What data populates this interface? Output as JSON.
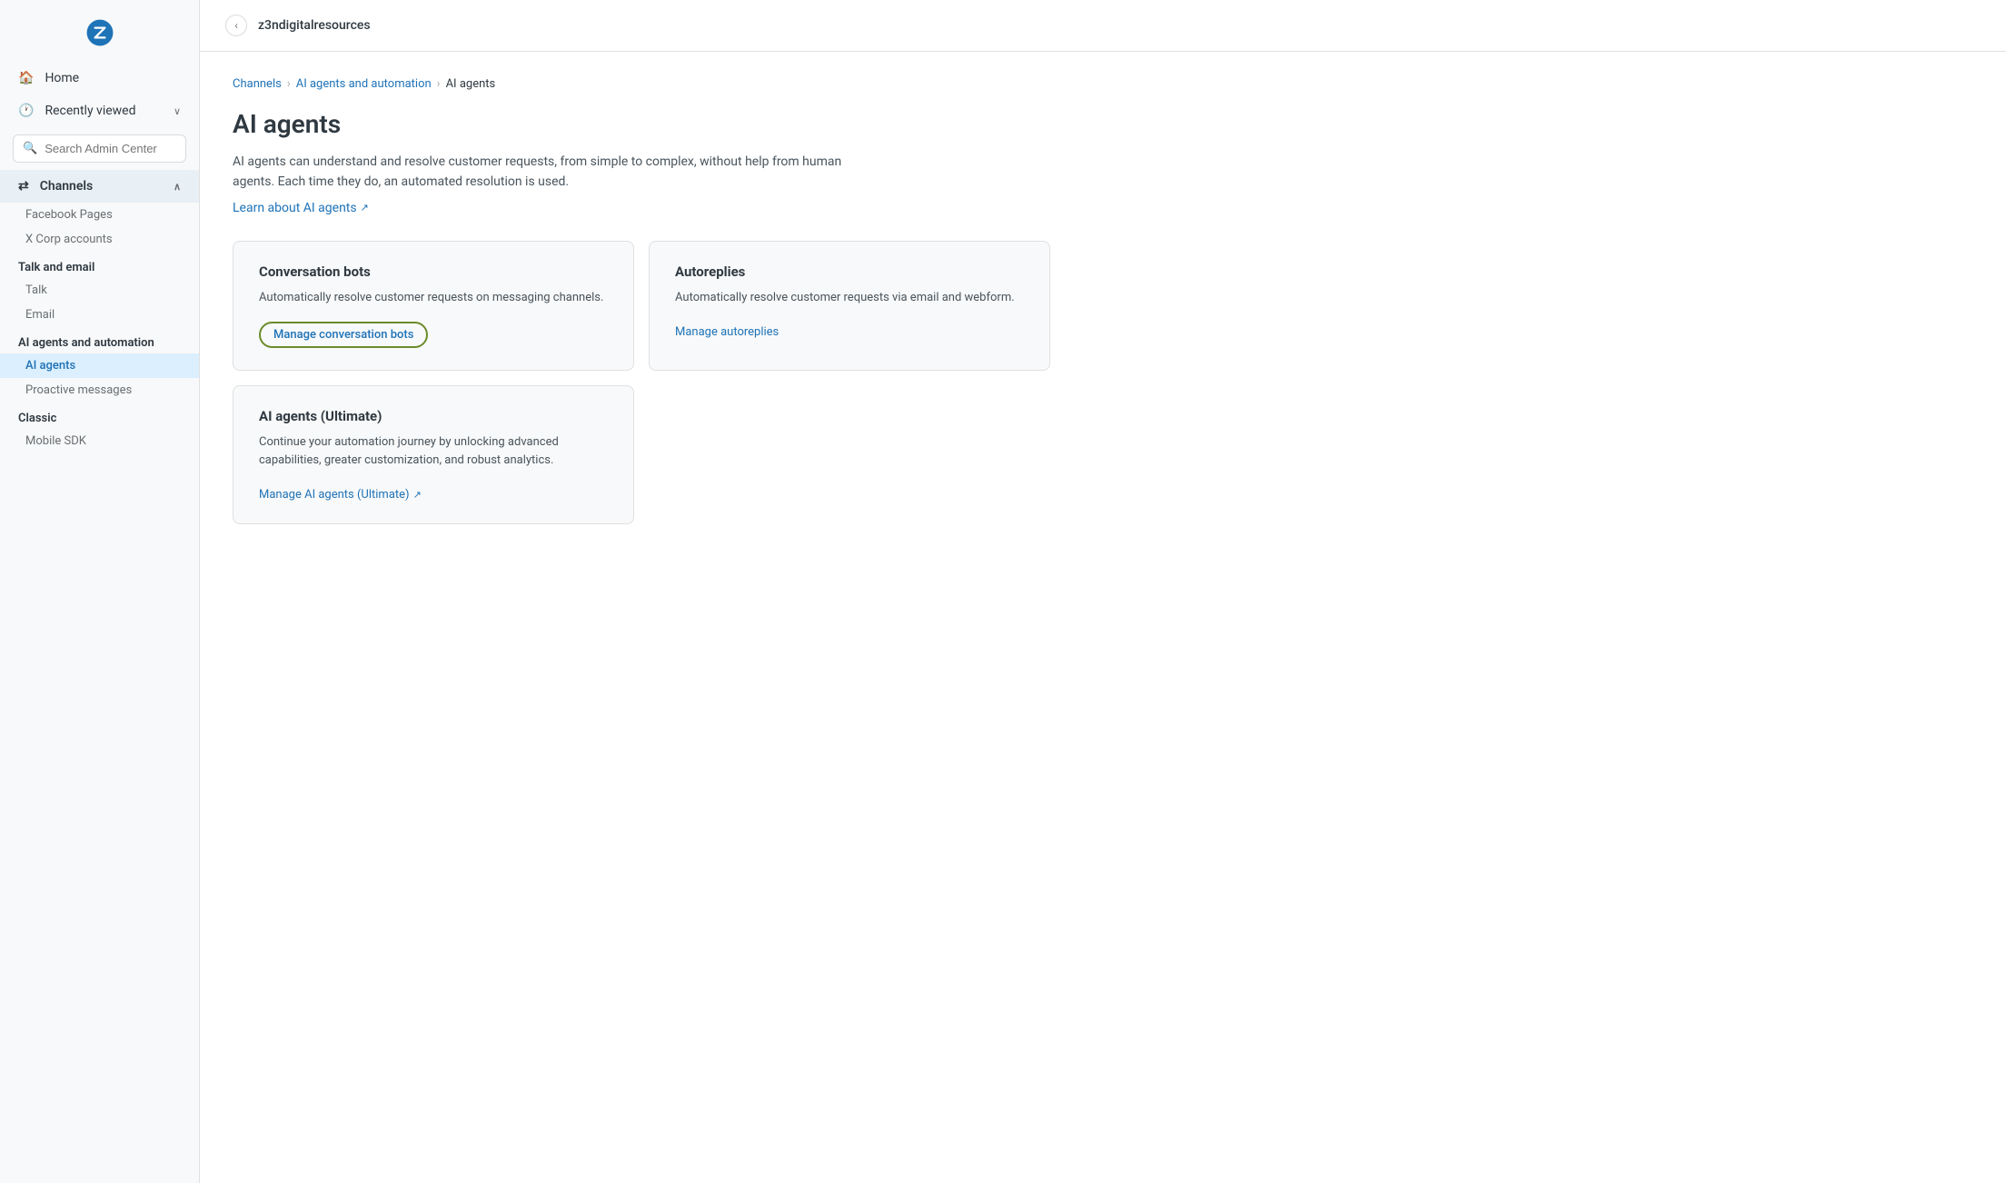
{
  "sidebar": {
    "logo_alt": "Zendesk",
    "nav": [
      {
        "id": "home",
        "label": "Home",
        "icon": "🏠"
      },
      {
        "id": "recently-viewed",
        "label": "Recently viewed",
        "icon": "🕐",
        "has_chevron": true,
        "chevron": "∧"
      }
    ],
    "search_placeholder": "Search Admin Center",
    "channels_label": "Channels",
    "channels_chevron": "∧",
    "channels_icon": "⇄",
    "sections": [
      {
        "id": "channels-links",
        "links": [
          {
            "id": "facebook",
            "label": "Facebook Pages",
            "active": false
          },
          {
            "id": "xcorp",
            "label": "X Corp accounts",
            "active": false
          }
        ]
      },
      {
        "id": "talk-email",
        "label": "Talk and email",
        "links": [
          {
            "id": "talk",
            "label": "Talk",
            "active": false
          },
          {
            "id": "email",
            "label": "Email",
            "active": false
          }
        ]
      },
      {
        "id": "ai-agents",
        "label": "AI agents and automation",
        "links": [
          {
            "id": "ai-agents-link",
            "label": "AI agents",
            "active": true
          },
          {
            "id": "proactive-messages",
            "label": "Proactive messages",
            "active": false
          }
        ]
      },
      {
        "id": "classic",
        "label": "Classic",
        "links": [
          {
            "id": "mobile-sdk",
            "label": "Mobile SDK",
            "active": false
          }
        ]
      }
    ]
  },
  "topbar": {
    "title": "z3ndigitalresources",
    "collapse_icon": "‹"
  },
  "breadcrumb": {
    "items": [
      "Channels",
      "AI agents and automation",
      "AI agents"
    ],
    "separator": "›"
  },
  "page": {
    "title": "AI agents",
    "description": "AI agents can understand and resolve customer requests, from simple to complex, without help from human agents. Each time they do, an automated resolution is used.",
    "learn_link_text": "Learn about AI agents",
    "learn_link_icon": "↗"
  },
  "cards": [
    {
      "id": "conversation-bots",
      "title": "Conversation bots",
      "description": "Automatically resolve customer requests on messaging channels.",
      "link_text": "Manage conversation bots",
      "link_highlighted": true
    },
    {
      "id": "autoreplies",
      "title": "Autoreplies",
      "description": "Automatically resolve customer requests via email and webform.",
      "link_text": "Manage autoreplies",
      "link_highlighted": false
    },
    {
      "id": "ai-agents-ultimate",
      "title": "AI agents (Ultimate)",
      "description": "Continue your automation journey by unlocking advanced capabilities, greater customization, and robust analytics.",
      "link_text": "Manage AI agents (Ultimate)",
      "link_icon": "↗",
      "link_highlighted": false
    }
  ]
}
